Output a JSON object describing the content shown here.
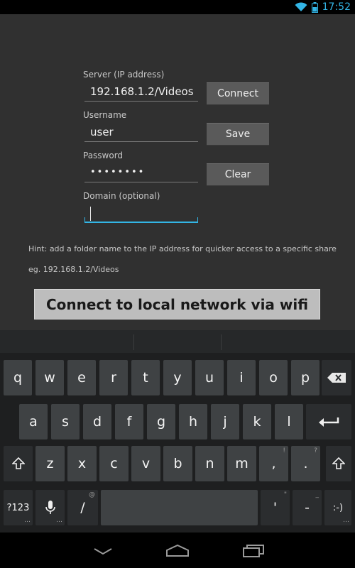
{
  "status_bar": {
    "time": "17:52"
  },
  "form": {
    "server_label": "Server (IP address)",
    "server_value": "192.168.1.2/Videos",
    "username_label": "Username",
    "username_value": "user",
    "password_label": "Password",
    "password_value": "••••••••",
    "domain_label": "Domain (optional)",
    "domain_value": ""
  },
  "buttons": {
    "connect": "Connect",
    "save": "Save",
    "clear": "Clear"
  },
  "hint": {
    "line1": "Hint: add a folder name to the IP address for quicker access to a specific share",
    "line2": "eg. 192.168.1.2/Videos"
  },
  "wifi_button": "Connect to local network via wifi",
  "keyboard": {
    "row1": [
      "q",
      "w",
      "e",
      "r",
      "t",
      "y",
      "u",
      "i",
      "o",
      "p"
    ],
    "row2": [
      "a",
      "s",
      "d",
      "f",
      "g",
      "h",
      "j",
      "k",
      "l"
    ],
    "row3": [
      "z",
      "x",
      "c",
      "v",
      "b",
      "n",
      "m",
      ",",
      "."
    ],
    "row3_hints": [
      "",
      "",
      "",
      "",
      "",
      "",
      "",
      "!",
      "?"
    ],
    "symbols": "?123",
    "slash": "/",
    "slash_hint": "@",
    "apostrophe": "'",
    "apostrophe_hint": "\"",
    "dash": "-",
    "dash_hint": "_",
    "smiley": ":-)"
  },
  "colors": {
    "accent": "#33b5e5",
    "background": "#303030"
  }
}
